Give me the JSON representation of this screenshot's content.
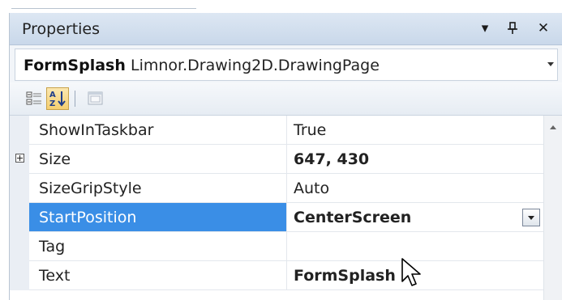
{
  "panel": {
    "title": "Properties",
    "buttons": [
      {
        "name": "dropdown",
        "glyph": "▾"
      },
      {
        "name": "pin",
        "glyph": "ᵽ"
      },
      {
        "name": "close",
        "glyph": "✕"
      }
    ]
  },
  "object_selector": {
    "name": "FormSplash",
    "type": "Limnor.Drawing2D.DrawingPage"
  },
  "toolbar": {
    "items": [
      "categorized-icon",
      "alphabetical-icon",
      "property-pages-icon"
    ],
    "active": "alphabetical-icon"
  },
  "grid": {
    "rows": [
      {
        "name": "ShowInTaskbar",
        "value": "True",
        "bold": false,
        "expandable": false,
        "selected": false
      },
      {
        "name": "Size",
        "value": "647, 430",
        "bold": true,
        "expandable": true,
        "selected": false
      },
      {
        "name": "SizeGripStyle",
        "value": "Auto",
        "bold": false,
        "expandable": false,
        "selected": false
      },
      {
        "name": "StartPosition",
        "value": "CenterScreen",
        "bold": true,
        "expandable": false,
        "selected": true
      },
      {
        "name": "Tag",
        "value": "",
        "bold": false,
        "expandable": false,
        "selected": false
      },
      {
        "name": "Text",
        "value": "FormSplash",
        "bold": true,
        "expandable": false,
        "selected": false
      }
    ]
  },
  "colors": {
    "selection": "#3a8ee6",
    "title_bar": "#d3e0ef"
  }
}
